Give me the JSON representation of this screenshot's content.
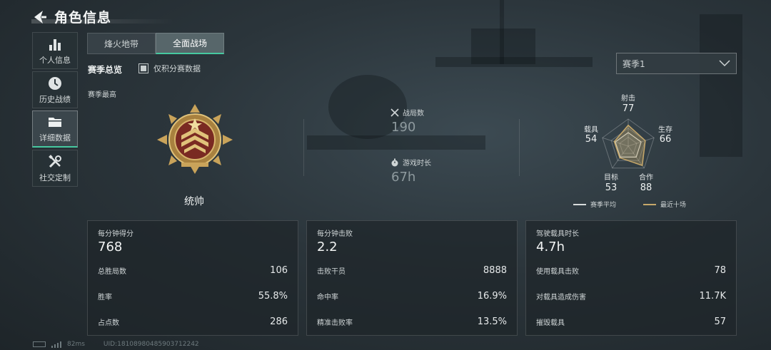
{
  "header": {
    "title": "角色信息"
  },
  "sidebar": {
    "items": [
      {
        "label": "个人信息",
        "icon": "bar-chart-icon"
      },
      {
        "label": "历史战绩",
        "icon": "clock-icon"
      },
      {
        "label": "详细数据",
        "icon": "folder-icon",
        "active": true
      },
      {
        "label": "社交定制",
        "icon": "tools-icon"
      }
    ]
  },
  "tabs": [
    {
      "label": "烽火地带"
    },
    {
      "label": "全面战场",
      "active": true
    }
  ],
  "overview": {
    "title": "赛季总览",
    "ranked_only_label": "仅积分赛数据",
    "season_high_label": "赛季最高",
    "rank_name": "统帅"
  },
  "season_select": {
    "value": "赛季1"
  },
  "mid_stats": {
    "matches": {
      "label": "战局数",
      "value": "190"
    },
    "playtime": {
      "label": "游戏时长",
      "value": "67h"
    }
  },
  "radar": {
    "axes": [
      {
        "label": "射击",
        "value": "77"
      },
      {
        "label": "生存",
        "value": "66"
      },
      {
        "label": "合作",
        "value": "88"
      },
      {
        "label": "目标",
        "value": "53"
      },
      {
        "label": "载具",
        "value": "54"
      }
    ],
    "season_avg": [
      0.5,
      0.5,
      0.5,
      0.5,
      0.5
    ],
    "recent": [
      0.77,
      0.66,
      0.88,
      0.53,
      0.54
    ],
    "legend_avg": "赛季平均",
    "legend_recent": "最近十场"
  },
  "cards": [
    {
      "title": "每分钟得分",
      "big": "768",
      "rows": [
        {
          "label": "总胜局数",
          "value": "106"
        },
        {
          "label": "胜率",
          "value": "55.8%"
        },
        {
          "label": "占点数",
          "value": "286"
        }
      ]
    },
    {
      "title": "每分钟击败",
      "big": "2.2",
      "rows": [
        {
          "label": "击败干员",
          "value": "8888"
        },
        {
          "label": "命中率",
          "value": "16.9%"
        },
        {
          "label": "精准击败率",
          "value": "13.5%"
        }
      ]
    },
    {
      "title": "驾驶载具时长",
      "big": "4.7h",
      "rows": [
        {
          "label": "使用载具击败",
          "value": "78"
        },
        {
          "label": "对载具造成伤害",
          "value": "11.7K"
        },
        {
          "label": "摧毁载具",
          "value": "57"
        }
      ]
    }
  ],
  "footer": {
    "ping": "82ms",
    "uid": "UID:18108980485903712242"
  },
  "colors": {
    "accent": "#46c9a0",
    "radar_recent": "#c7a86a",
    "radar_avg": "#d8dcdc"
  }
}
